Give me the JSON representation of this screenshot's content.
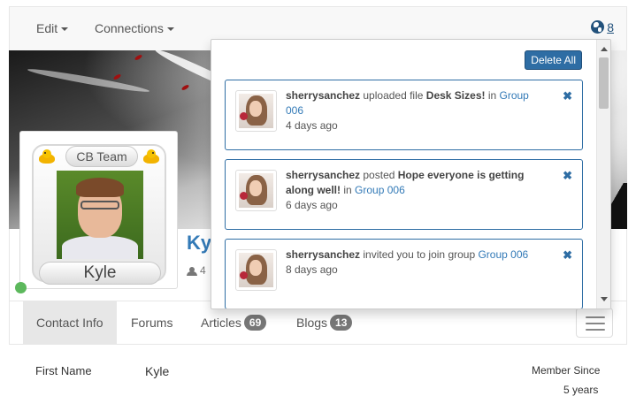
{
  "navbar": {
    "edit_label": "Edit",
    "connections_label": "Connections",
    "notification_count": "8"
  },
  "profile": {
    "team_label": "CB Team",
    "name_pill": "Kyle",
    "name_heading": "Kyle",
    "meta": "4"
  },
  "tabs": {
    "contact_info": "Contact Info",
    "forums": "Forums",
    "articles": "Articles",
    "articles_count": "69",
    "blogs": "Blogs",
    "blogs_count": "13"
  },
  "info": {
    "first_name_label": "First Name",
    "first_name_value": "Kyle",
    "member_since_label": "Member Since",
    "member_since_value": "5 years"
  },
  "notifications": {
    "delete_all_label": "Delete All",
    "items": [
      {
        "user": "sherrysanchez",
        "pre": " uploaded file ",
        "subject": "Desk Sizes!",
        "mid": " in ",
        "group": "Group 006",
        "time": "4 days ago"
      },
      {
        "user": "sherrysanchez",
        "pre": " posted ",
        "subject": "Hope everyone is getting along well!",
        "mid": " in ",
        "group": "Group 006",
        "time": "6 days ago"
      },
      {
        "user": "sherrysanchez",
        "pre": " invited you to join group ",
        "subject": "",
        "mid": "",
        "group": "Group 006",
        "time": "8 days ago"
      }
    ]
  },
  "colors": {
    "accent": "#2e6da4",
    "link": "#337ab7",
    "online": "#5cb85c",
    "badge": "#777777"
  }
}
